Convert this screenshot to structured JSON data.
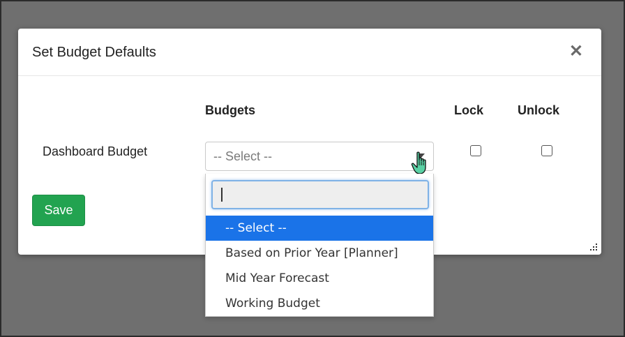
{
  "dialog": {
    "title": "Set Budget Defaults",
    "close_symbol": "✕",
    "columns": {
      "budgets": "Budgets",
      "lock": "Lock",
      "unlock": "Unlock"
    },
    "rows": [
      {
        "label": "Dashboard Budget",
        "select_value": "-- Select --",
        "lock_checked": false,
        "unlock_checked": false
      }
    ],
    "save_label": "Save"
  },
  "dropdown": {
    "search_value": "",
    "options": [
      {
        "label": "-- Select --",
        "selected": true
      },
      {
        "label": "Based on Prior Year [Planner]",
        "selected": false
      },
      {
        "label": "Mid Year Forecast",
        "selected": false
      },
      {
        "label": "Working Budget",
        "selected": false
      }
    ]
  },
  "colors": {
    "overlay": "#6f6f6f",
    "save_green": "#22a350",
    "selected_blue": "#1a73e8",
    "search_focus": "#7fb2e6"
  },
  "icons": {
    "close": "close-icon",
    "select_arrow": "chevron-down-icon",
    "cursor": "hand-pointer-icon",
    "resize": "resize-grip-icon"
  }
}
